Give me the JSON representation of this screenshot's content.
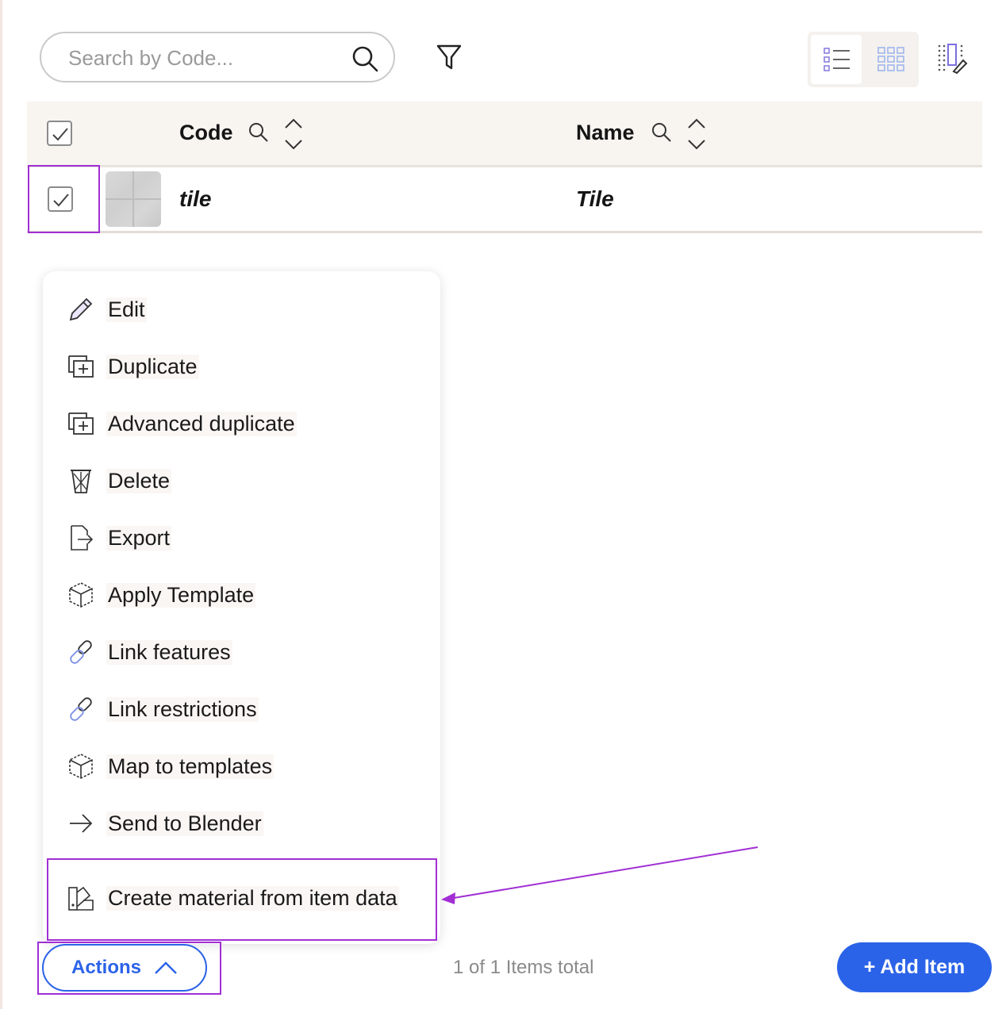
{
  "search": {
    "placeholder": "Search by Code..."
  },
  "table": {
    "columns": [
      {
        "label": "Code"
      },
      {
        "label": "Name"
      }
    ],
    "rows": [
      {
        "code": "tile",
        "name": "Tile",
        "selected": true
      }
    ]
  },
  "actions_menu": {
    "items": [
      {
        "label": "Edit",
        "icon": "pencil-icon"
      },
      {
        "label": "Duplicate",
        "icon": "duplicate-icon"
      },
      {
        "label": "Advanced duplicate",
        "icon": "duplicate-icon"
      },
      {
        "label": "Delete",
        "icon": "trash-icon"
      },
      {
        "label": "Export",
        "icon": "export-icon"
      },
      {
        "label": "Apply Template",
        "icon": "cube-icon"
      },
      {
        "label": "Link features",
        "icon": "link-icon"
      },
      {
        "label": "Link restrictions",
        "icon": "link-icon"
      },
      {
        "label": "Map to templates",
        "icon": "cube-icon"
      },
      {
        "label": "Send to Blender",
        "icon": "arrow-right-icon"
      },
      {
        "label": "Create material from item data",
        "icon": "material-icon"
      }
    ]
  },
  "footer": {
    "actions_label": "Actions",
    "count_text": "1 of 1 Items total",
    "add_item_label": "+ Add Item"
  },
  "colors": {
    "accent": "#2b63e8",
    "annotation": "#a12fd4",
    "header_bg": "#f8f5f1"
  }
}
